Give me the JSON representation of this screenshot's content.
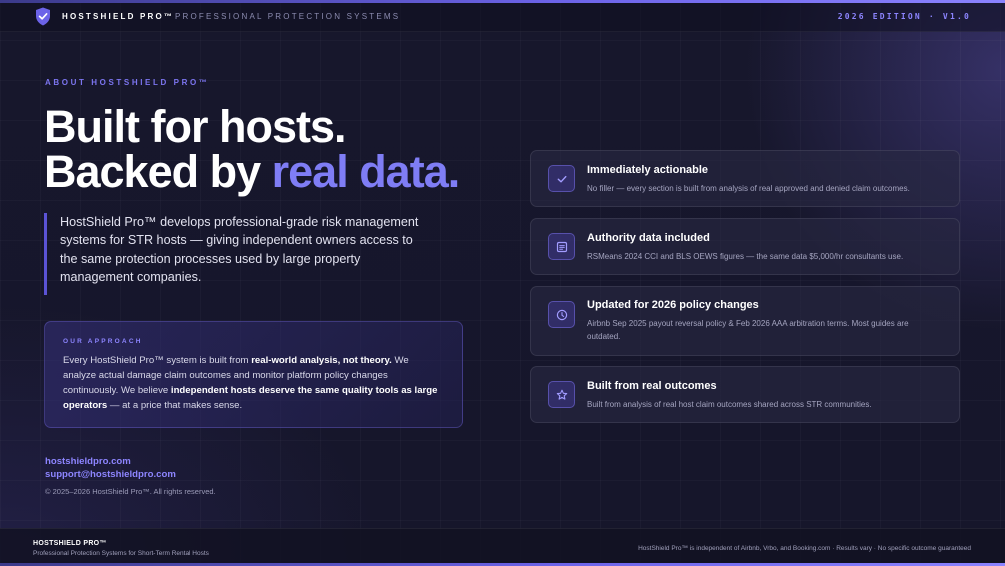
{
  "header": {
    "brand": "HOSTSHIELD PRO™",
    "separator": "·",
    "tagline": "PROFESSIONAL PROTECTION SYSTEMS",
    "edition": "2026 EDITION · V1.0",
    "logo_icon": "shield-check-icon"
  },
  "hero": {
    "eyebrow": "ABOUT HOSTSHIELD PRO™",
    "headline_line1": "Built for hosts.",
    "headline_line2_prefix": "Backed by ",
    "headline_line2_accent": "real data.",
    "intro": "HostShield Pro™ develops professional-grade risk management systems for STR hosts — giving independent owners access to the same protection processes used by large property management companies."
  },
  "approach": {
    "label": "OUR APPROACH",
    "text_1": "Every HostShield Pro™ system is built from ",
    "bold_1": "real-world analysis, not theory.",
    "text_2": " We analyze actual damage claim outcomes and monitor platform policy changes continuously. We believe ",
    "bold_2": "independent hosts deserve the same quality tools as large operators",
    "text_3": " — at a price that makes sense."
  },
  "contact": {
    "website": "hostshieldpro.com",
    "email": "support@hostshieldpro.com",
    "copyright": "© 2025–2026 HostShield Pro™. All rights reserved."
  },
  "features": [
    {
      "icon": "check-icon",
      "title": "Immediately actionable",
      "description": "No filler — every section is built from analysis of real approved and denied claim outcomes."
    },
    {
      "icon": "document-icon",
      "title": "Authority data included",
      "description": "RSMeans 2024 CCI and BLS OEWS figures — the same data $5,000/hr consultants use."
    },
    {
      "icon": "clock-icon",
      "title": "Updated for 2026 policy changes",
      "description": "Airbnb Sep 2025 payout reversal policy & Feb 2026 AAA arbitration terms. Most guides are outdated."
    },
    {
      "icon": "star-icon",
      "title": "Built from real outcomes",
      "description": "Built from analysis of real host claim outcomes shared across STR communities."
    }
  ],
  "footer": {
    "brand": "HOSTSHIELD PRO™",
    "subtitle": "Professional Protection Systems for Short-Term Rental Hosts",
    "disclaimer": "HostShield Pro™ is independent of Airbnb, Vrbo, and Booking.com · Results vary · No specific outcome guaranteed"
  },
  "colors": {
    "accent": "#7f7df5",
    "brand_purple": "#6c63e8",
    "background": "#15152a"
  }
}
